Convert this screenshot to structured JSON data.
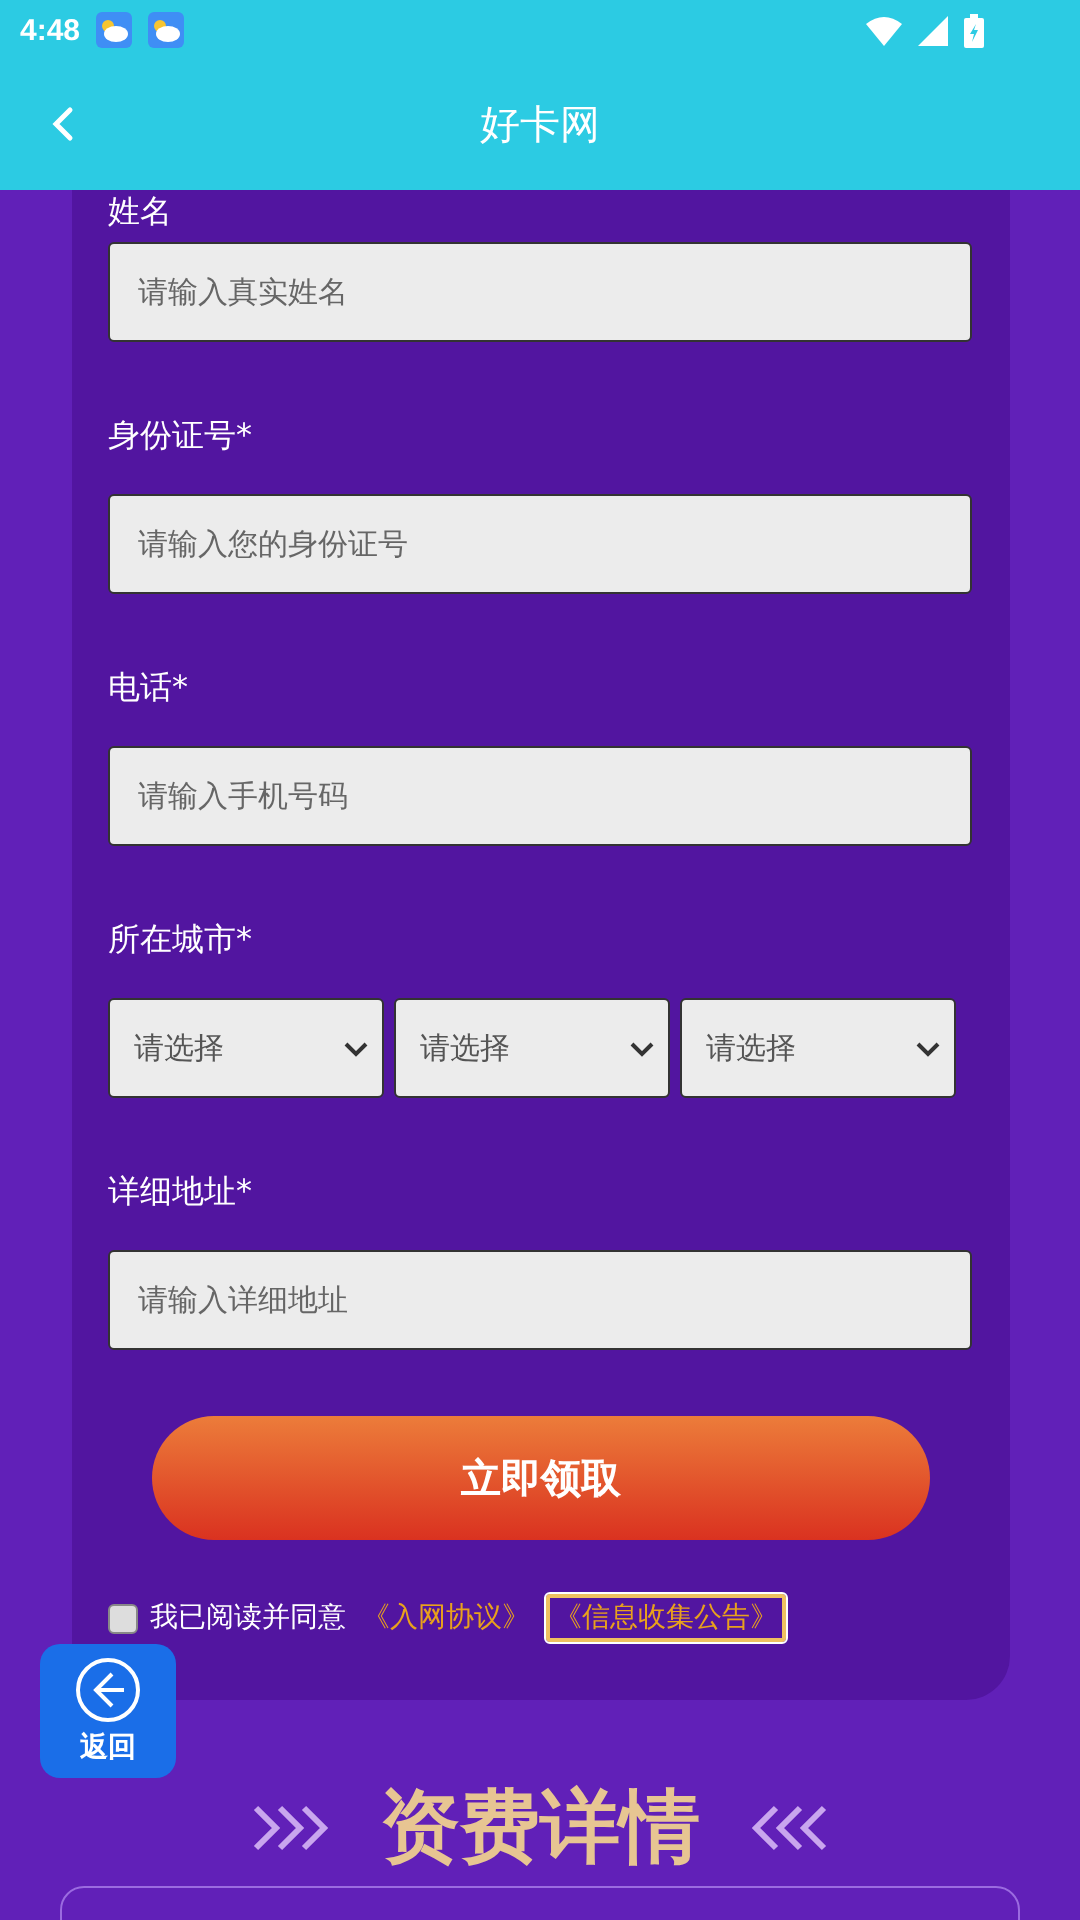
{
  "status_bar": {
    "time": "4:48"
  },
  "header": {
    "title": "好卡网"
  },
  "form": {
    "fields": [
      {
        "label": "姓名",
        "placeholder": "请输入真实姓名"
      },
      {
        "label": "身份证号*",
        "placeholder": "请输入您的身份证号"
      },
      {
        "label": "电话*",
        "placeholder": "请输入手机号码"
      }
    ],
    "city": {
      "label": "所在城市*",
      "selects": [
        "请选择",
        "请选择",
        "请选择"
      ]
    },
    "address": {
      "label": "详细地址*",
      "placeholder": "请输入详细地址"
    },
    "submit": "立即领取",
    "agreement": {
      "checked": false,
      "text": "我已阅读并同意",
      "links": [
        {
          "text": "《入网协议》",
          "selected": false
        },
        {
          "text": "《信息收集公告》",
          "selected": true
        }
      ]
    }
  },
  "float_button": {
    "label": "返回"
  },
  "section_title": "资费详情"
}
